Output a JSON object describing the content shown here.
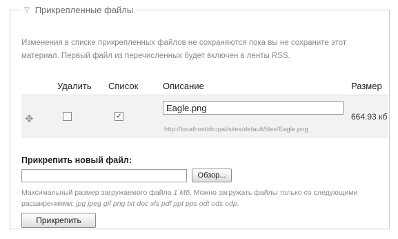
{
  "fieldset": {
    "legend": "Прикрепленные файлы",
    "legend_icon": "collapse-triangle-icon",
    "description": "Изменения в списке прикрепленных файлов не сохраняются пока вы не сохраните этот материал. Первый файл из перечисленных будет включен в ленты RSS."
  },
  "table": {
    "headers": {
      "delete": "Удалить",
      "list": "Список",
      "description": "Описание",
      "size": "Размер"
    },
    "rows": [
      {
        "delete_checked": false,
        "list_checked": true,
        "description_value": "Eagle.png",
        "url": "http://localhost/drupal/sites/default/files/Eagle.png",
        "size": "664.93 кб"
      }
    ]
  },
  "attach": {
    "label": "Прикрепить новый файл:",
    "file_value": "",
    "browse_label": "Обзор...",
    "hint_prefix": "Максимальный размер загружаемого файла ",
    "hint_max_size": "1 Мб",
    "hint_mid": ". Можно загружать файлы только со следующими расширениями: ",
    "hint_extensions": "jpg jpeg gif png txt doc xls pdf ppt pps odt ods odp",
    "hint_suffix": ".",
    "submit_label": "Прикрепить"
  },
  "icons": {
    "drag": "drag-handle-icon",
    "check": "checkmark-icon"
  },
  "colors": {
    "row_background": "#f2f2f2",
    "border": "#cfcfcf",
    "muted_text": "#8a8a8a"
  }
}
